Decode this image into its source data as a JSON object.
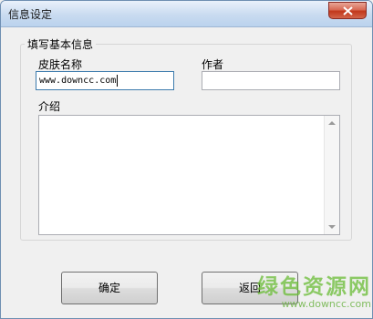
{
  "window": {
    "title": "信息设定"
  },
  "group": {
    "legend": "填写基本信息",
    "skin_name_label": "皮肤名称",
    "skin_name_value": "www.downcc.com",
    "author_label": "作者",
    "author_value": "",
    "intro_label": "介绍",
    "intro_value": ""
  },
  "buttons": {
    "confirm": "确定",
    "back": "返回"
  },
  "watermark": {
    "main": "绿色资源网",
    "sub": "www.downcc.com"
  },
  "colors": {
    "title_bar": "#c9dbf0",
    "close_button": "#c2381c",
    "watermark": "#6ebe3c"
  }
}
